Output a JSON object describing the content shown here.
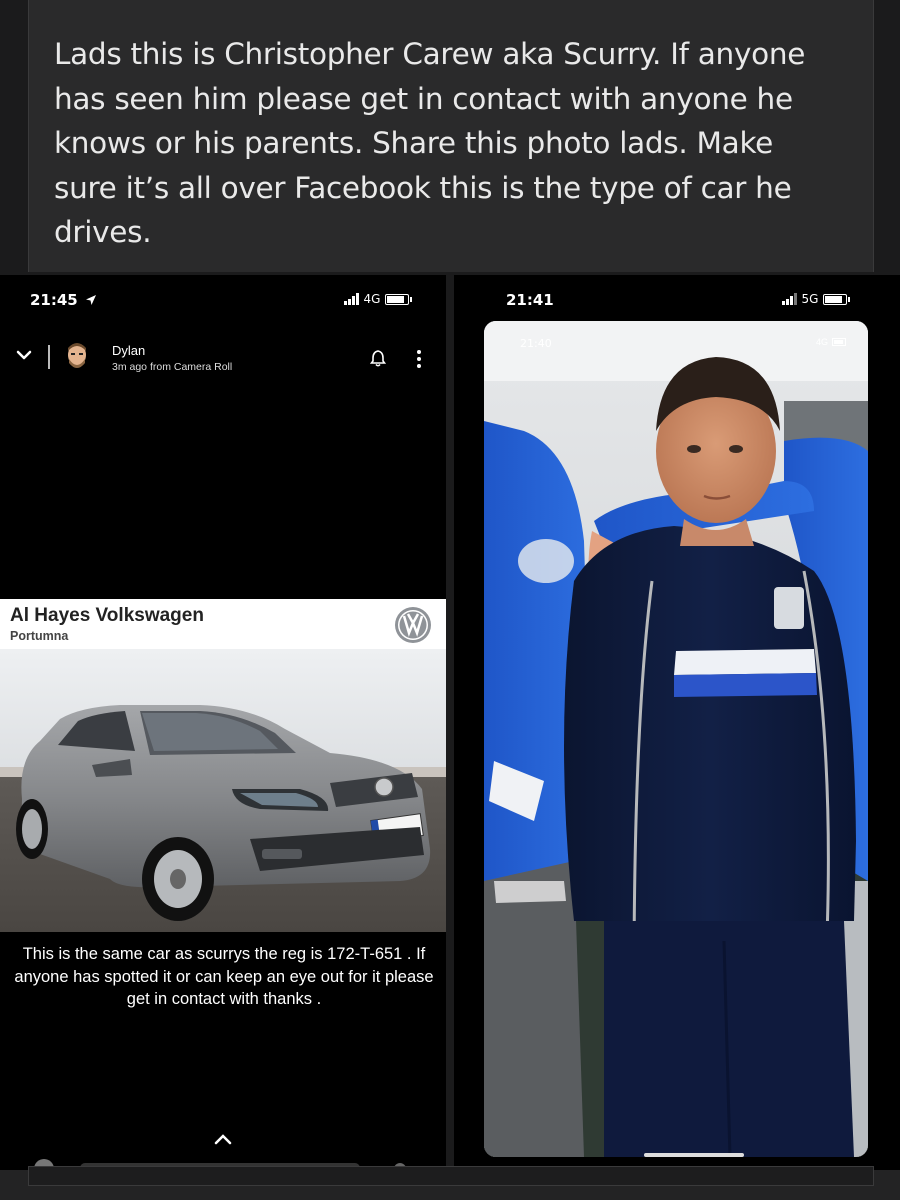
{
  "post": {
    "text": "Lads this is Christopher Carew aka Scurry. If anyone has seen him please get in contact with anyone he knows or his parents. Share this photo lads. Make sure it’s all over Facebook this is the type of car he drives."
  },
  "left_screen": {
    "time": "21:45",
    "network": "4G",
    "story": {
      "user": "Dylan",
      "subtitle": "3m ago from Camera Roll"
    },
    "ad": {
      "dealer": "Al Hayes Volkswagen",
      "location": "Portumna",
      "plate": "172-T-651"
    },
    "caption": "This is the same car as scurrys the reg is 172-T-651 . If anyone has spotted it or can keep an eye out for it please get in contact with thanks ."
  },
  "right_screen": {
    "time": "21:41",
    "network": "5G",
    "inner_time": "21:40",
    "inner_network": "4G"
  },
  "colors": {
    "background": "#1b1b1c",
    "post_box": "#2a2a2b",
    "car_grey": "#8b8c8e",
    "jacket_navy": "#0d1a3a",
    "shirt_blue": "#2f56d0"
  }
}
